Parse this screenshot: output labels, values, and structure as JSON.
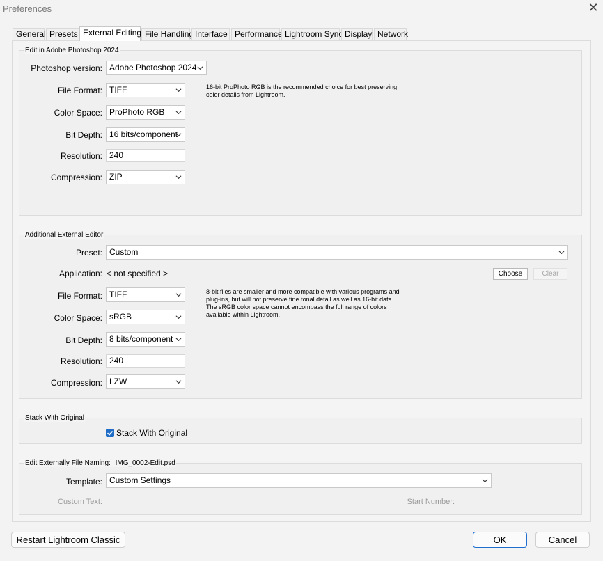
{
  "window": {
    "title": "Preferences",
    "close_glyph": "✕"
  },
  "tabs": [
    {
      "label": "General"
    },
    {
      "label": "Presets"
    },
    {
      "label": "External Editing",
      "active": true
    },
    {
      "label": "File Handling"
    },
    {
      "label": "Interface"
    },
    {
      "label": "Performance"
    },
    {
      "label": "Lightroom Sync"
    },
    {
      "label": "Display"
    },
    {
      "label": "Network"
    }
  ],
  "photoshop": {
    "legend": "Edit in Adobe Photoshop 2024",
    "version_label": "Photoshop version:",
    "version_value": "Adobe Photoshop 2024",
    "format_label": "File Format:",
    "format_value": "TIFF",
    "colorspace_label": "Color Space:",
    "colorspace_value": "ProPhoto RGB",
    "bitdepth_label": "Bit Depth:",
    "bitdepth_value": "16 bits/component",
    "resolution_label": "Resolution:",
    "resolution_value": "240",
    "compression_label": "Compression:",
    "compression_value": "ZIP",
    "note_line1": "16-bit ProPhoto RGB is the recommended choice for best preserving",
    "note_line2": "color details from Lightroom."
  },
  "additional": {
    "legend": "Additional External Editor",
    "preset_label": "Preset:",
    "preset_value": "Custom",
    "application_label": "Application:",
    "application_value": "< not specified >",
    "choose_label": "Choose",
    "clear_label": "Clear",
    "format_label": "File Format:",
    "format_value": "TIFF",
    "colorspace_label": "Color Space:",
    "colorspace_value": "sRGB",
    "bitdepth_label": "Bit Depth:",
    "bitdepth_value": "8 bits/component",
    "resolution_label": "Resolution:",
    "resolution_value": "240",
    "compression_label": "Compression:",
    "compression_value": "LZW",
    "note_line1": "8-bit files are smaller and more compatible with various programs and",
    "note_line2": "plug-ins, but will not preserve fine tonal detail as well as 16-bit data.",
    "note_line3": "The sRGB color space cannot encompass the full range of colors",
    "note_line4": "available within Lightroom."
  },
  "stack": {
    "legend": "Stack With Original",
    "checkbox_label": "Stack With Original",
    "checked": true
  },
  "naming": {
    "legend": "Edit Externally File Naming:",
    "example": "IMG_0002-Edit.psd",
    "template_label": "Template:",
    "template_value": "Custom Settings",
    "custom_text_label": "Custom Text:",
    "start_number_label": "Start Number:"
  },
  "footer": {
    "restart_label": "Restart Lightroom Classic",
    "ok_label": "OK",
    "cancel_label": "Cancel"
  },
  "colors": {
    "accent": "#1f6dc7",
    "ok_border": "#1e6fd0"
  },
  "icons": {
    "dropdown": "chevron-down-icon",
    "check": "checkmark-icon",
    "close": "close-icon"
  }
}
